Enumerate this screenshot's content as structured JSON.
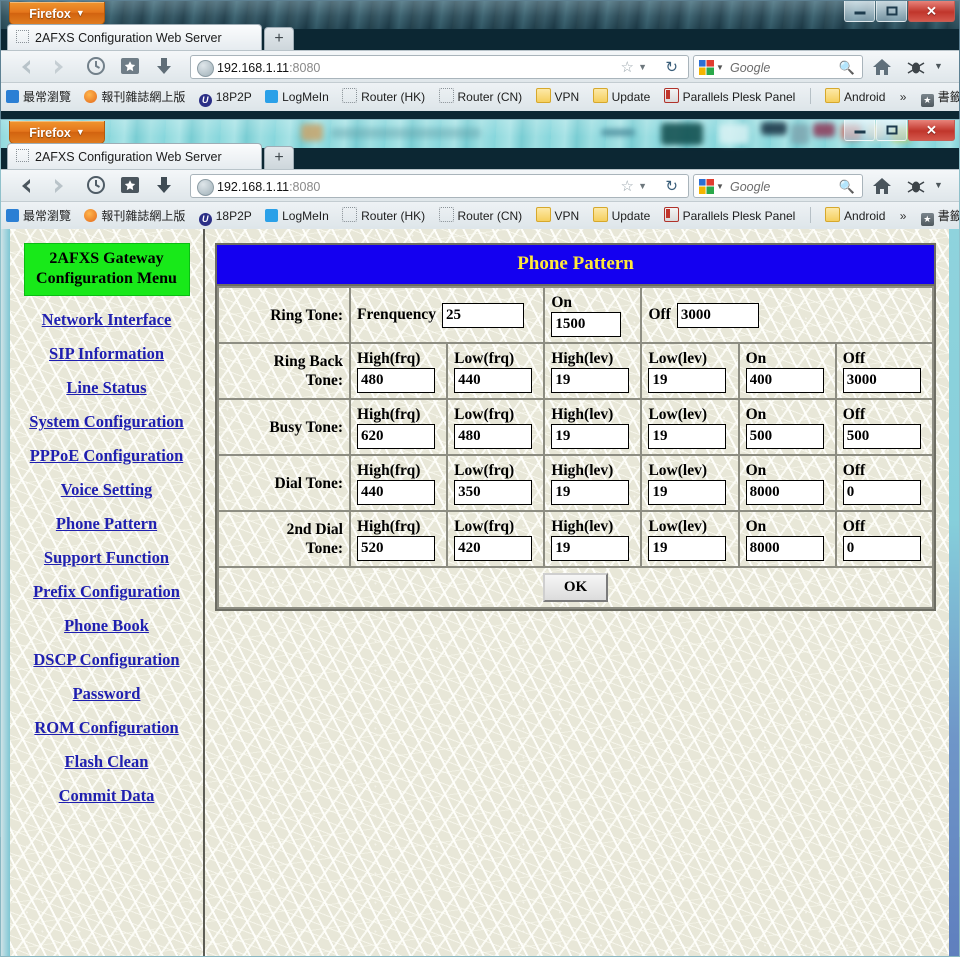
{
  "browser": {
    "app_button": "Firefox",
    "tab_title": "2AFXS Configuration Web Server",
    "new_tab_label": "+",
    "url_host": "192.168.1.11",
    "url_port": ":8080",
    "search_placeholder": "Google",
    "window_controls": {
      "minimize": "–",
      "maximize": "□",
      "close": "✕"
    },
    "nav_icons": [
      "back-arrow-icon",
      "forward-arrow-icon",
      "history-clock-icon",
      "bookmarks-star-icon",
      "downloads-arrow-icon"
    ],
    "bookmarks": [
      {
        "label": "最常瀏覽",
        "icon": "most-visited-icon"
      },
      {
        "label": "報刊雜誌網上版",
        "icon": "orange-dot-icon"
      },
      {
        "label": "18P2P",
        "icon": "p2p-icon"
      },
      {
        "label": "LogMeIn",
        "icon": "logmein-icon"
      },
      {
        "label": "Router (HK)",
        "icon": "dotted-page-icon"
      },
      {
        "label": "Router (CN)",
        "icon": "dotted-page-icon"
      },
      {
        "label": "VPN",
        "icon": "folder-icon"
      },
      {
        "label": "Update",
        "icon": "folder-icon"
      },
      {
        "label": "Parallels Plesk Panel",
        "icon": "plesk-icon"
      },
      {
        "label": "Android",
        "icon": "folder-icon"
      }
    ],
    "bookmarks_overflow": "»",
    "bookmarks_menu_label": "書籤"
  },
  "sidebar": {
    "heading_line1": "2AFXS Gateway",
    "heading_line2": "Configuration Menu",
    "items": [
      {
        "label": "Network Interface"
      },
      {
        "label": "SIP Information"
      },
      {
        "label": "Line Status"
      },
      {
        "label": "System Configuration"
      },
      {
        "label": "PPPoE Configuration"
      },
      {
        "label": "Voice Setting"
      },
      {
        "label": "Phone Pattern"
      },
      {
        "label": "Support Function"
      },
      {
        "label": "Prefix Configuration"
      },
      {
        "label": "Phone Book"
      },
      {
        "label": "DSCP Configuration"
      },
      {
        "label": "Password"
      },
      {
        "label": "ROM Configuration"
      },
      {
        "label": "Flash Clean"
      },
      {
        "label": "Commit Data"
      }
    ]
  },
  "main": {
    "panel_title": "Phone Pattern",
    "ring_tone": {
      "row_label": "Ring Tone:",
      "freq_label": "Frenquency",
      "freq_value": "25",
      "on_label": "On",
      "on_value": "1500",
      "off_label": "Off",
      "off_value": "3000"
    },
    "column_labels": {
      "high_frq": "High(frq)",
      "low_frq": "Low(frq)",
      "high_lev": "High(lev)",
      "low_lev": "Low(lev)",
      "on": "On",
      "off": "Off"
    },
    "rows": [
      {
        "label_line1": "Ring Back",
        "label_line2": "Tone:",
        "high_frq": "480",
        "low_frq": "440",
        "high_lev": "19",
        "low_lev": "19",
        "on": "400",
        "off": "3000"
      },
      {
        "label_line1": "Busy Tone:",
        "label_line2": "",
        "high_frq": "620",
        "low_frq": "480",
        "high_lev": "19",
        "low_lev": "19",
        "on": "500",
        "off": "500"
      },
      {
        "label_line1": "Dial Tone:",
        "label_line2": "",
        "high_frq": "440",
        "low_frq": "350",
        "high_lev": "19",
        "low_lev": "19",
        "on": "8000",
        "off": "0"
      },
      {
        "label_line1": "2nd Dial",
        "label_line2": "Tone:",
        "high_frq": "520",
        "low_frq": "420",
        "high_lev": "19",
        "low_lev": "19",
        "on": "8000",
        "off": "0"
      }
    ],
    "ok_button": "OK"
  },
  "colors": {
    "title_bar_bg": "#1400f0",
    "title_bar_text": "#ffe93a",
    "menu_heading_bg": "#18e919",
    "link": "#1f1fb0",
    "page_bg": "#e8e7d8",
    "firefox_orange": "#e4751b"
  }
}
